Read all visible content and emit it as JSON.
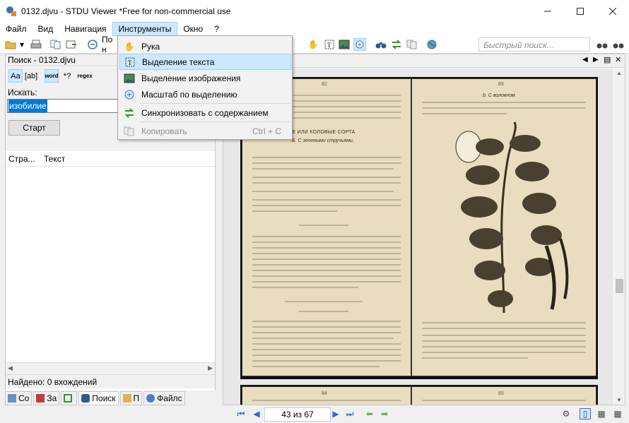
{
  "window": {
    "title": "0132.djvu - STDU Viewer *Free for non-commercial use",
    "minimize_icon": "minimize-icon",
    "maximize_icon": "maximize-icon",
    "close_icon": "close-icon"
  },
  "menubar": {
    "items": [
      "Файл",
      "Вид",
      "Навигация",
      "Инструменты",
      "Окно",
      "?"
    ],
    "active_index": 3
  },
  "toolbar": {
    "partial_label": "По н",
    "quick_search_placeholder": "Быстрый поиск..."
  },
  "tools_menu": {
    "items": [
      {
        "label": "Рука",
        "icon": "hand-icon",
        "enabled": true
      },
      {
        "label": "Выделение текста",
        "icon": "text-select-icon",
        "enabled": true,
        "highlighted": true
      },
      {
        "label": "Выделение изображения",
        "icon": "image-select-icon",
        "enabled": true
      },
      {
        "label": "Масштаб по выделению",
        "icon": "zoom-select-icon",
        "enabled": true
      },
      {
        "label": "Синхронизовать с содержанием",
        "icon": "sync-icon",
        "enabled": true
      },
      {
        "label": "Копировать",
        "icon": "copy-icon",
        "enabled": false,
        "shortcut": "Ctrl + C"
      }
    ]
  },
  "search_panel": {
    "header": "Поиск - 0132.djvu",
    "option_labels": [
      "Aa",
      "[ab]",
      "word",
      "*?",
      "regex"
    ],
    "search_label": "Искать:",
    "search_value": "изобилие",
    "start_button": "Старт",
    "columns": [
      "Стра...",
      "Текст"
    ],
    "found_text": "Найдено: 0 вхождений"
  },
  "bottom_tabs": [
    {
      "label": "Со",
      "icon": "contents-icon"
    },
    {
      "label": "За",
      "icon": "bookmarks-icon"
    },
    {
      "label": "",
      "icon": "thumbnails-icon"
    },
    {
      "label": "Поиск",
      "icon": "binoculars-icon",
      "active": true
    },
    {
      "label": "П",
      "icon": "pages-icon"
    },
    {
      "label": "Файлс",
      "icon": "files-icon"
    }
  ],
  "document": {
    "page_indicator": "43 из 67",
    "left_page_number": "82",
    "right_page_number": "83",
    "next_left_page_number": "84",
    "next_right_page_number": "85",
    "left_heading": "НИЗКОРОСЛЫЕ ИЛИ КОЛОВЫЕ СОРТА",
    "left_subheading": "Б. С зелеными стручьями.",
    "right_subheading": "b. С волокном.",
    "page_bg": "#e9dcbf"
  },
  "colors": {
    "accent": "#0078d7",
    "highlight_bg": "#cce8ff",
    "highlight_border": "#99d1ff"
  }
}
